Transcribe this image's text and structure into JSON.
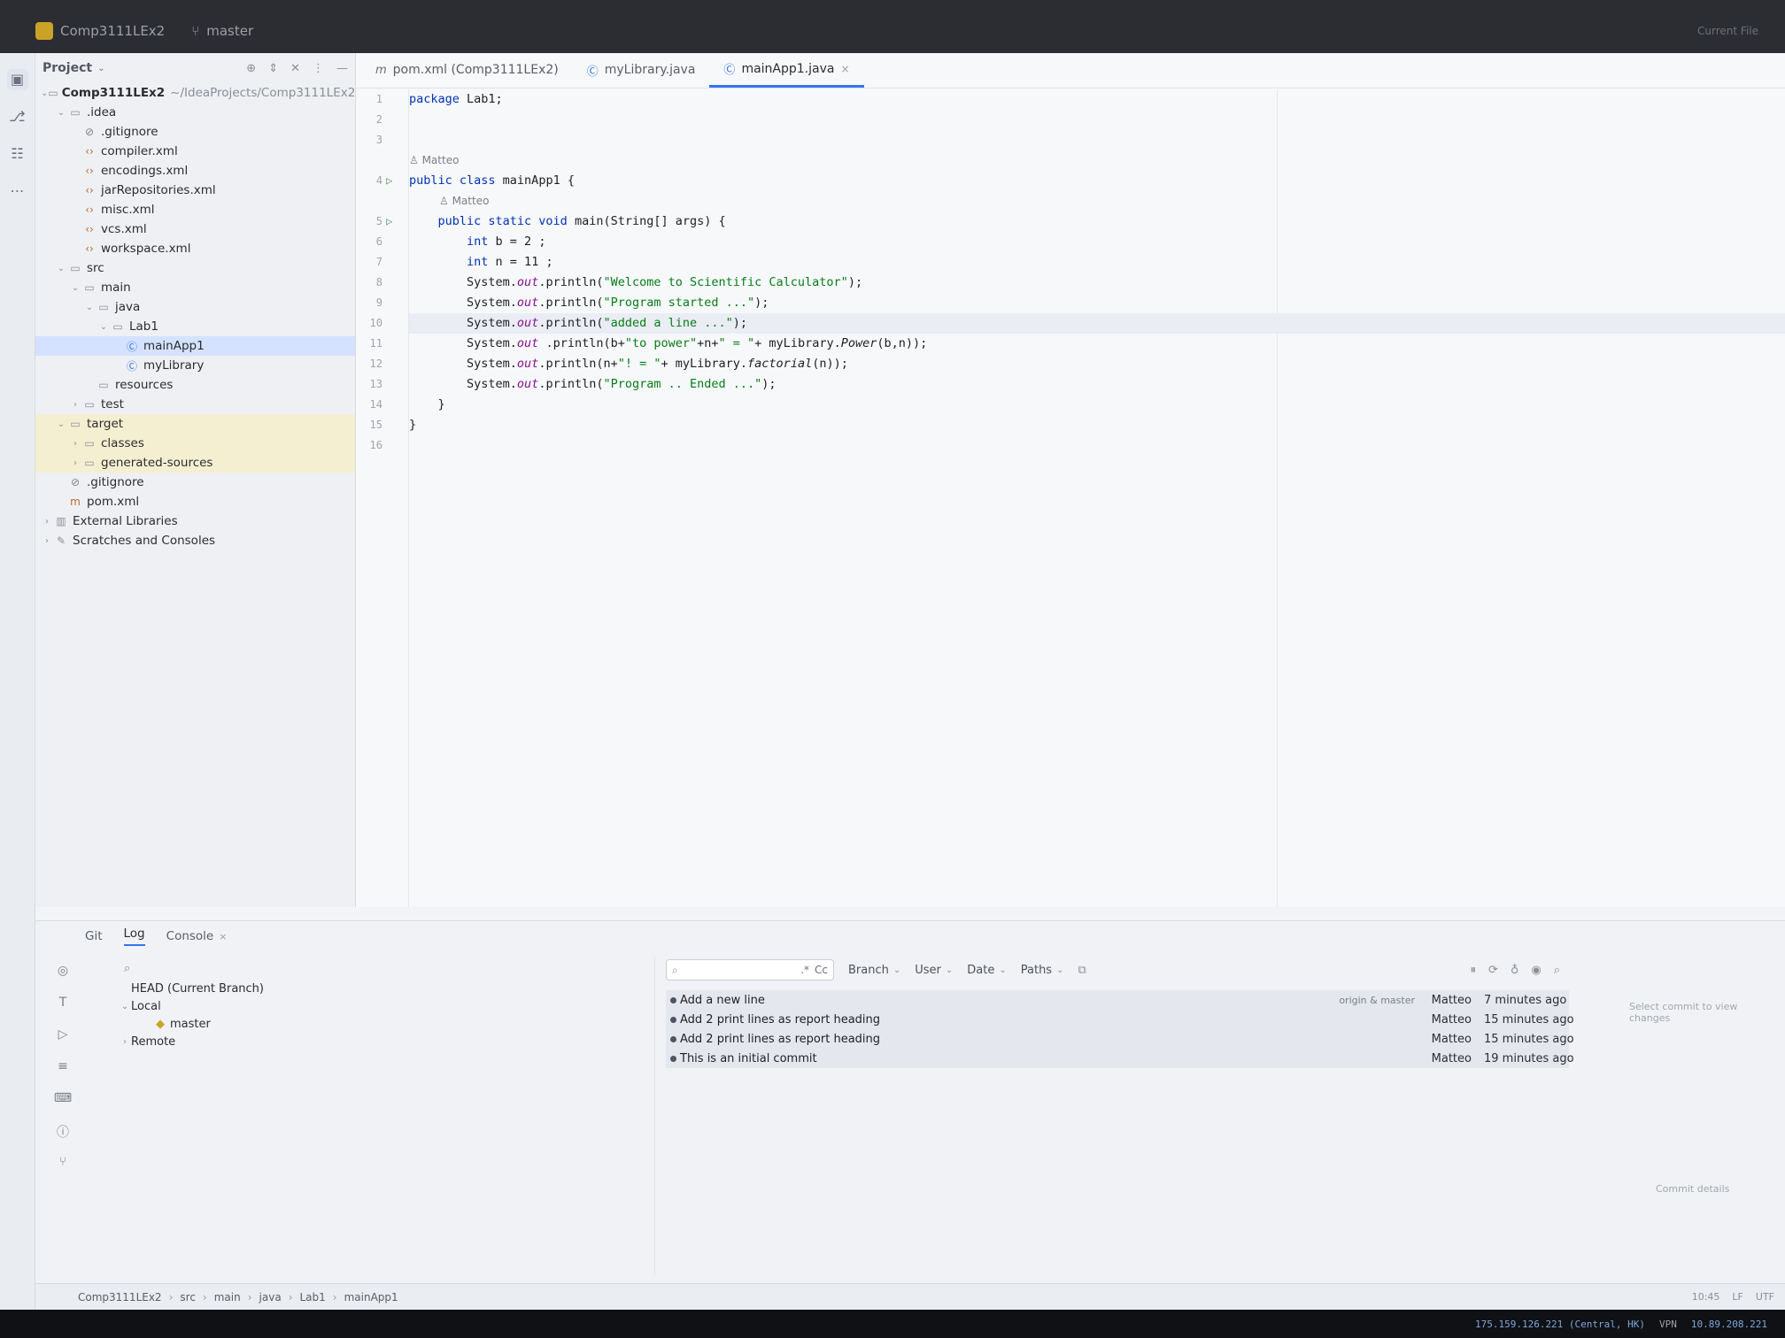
{
  "titlebar": {
    "project": "Comp3111LEx2",
    "branch": "master",
    "right_text": "Current File"
  },
  "project_panel": {
    "title": "Project",
    "tree": [
      {
        "label": "Comp3111LEx2",
        "extra": "~/IdeaProjects/Comp3111LEx2",
        "depth": 0,
        "icon": "folder",
        "open": true,
        "bold": true
      },
      {
        "label": ".idea",
        "depth": 1,
        "icon": "folder",
        "open": true
      },
      {
        "label": ".gitignore",
        "depth": 2,
        "icon": "ignore"
      },
      {
        "label": "compiler.xml",
        "depth": 2,
        "icon": "xml"
      },
      {
        "label": "encodings.xml",
        "depth": 2,
        "icon": "xml"
      },
      {
        "label": "jarRepositories.xml",
        "depth": 2,
        "icon": "xml"
      },
      {
        "label": "misc.xml",
        "depth": 2,
        "icon": "xml"
      },
      {
        "label": "vcs.xml",
        "depth": 2,
        "icon": "xml"
      },
      {
        "label": "workspace.xml",
        "depth": 2,
        "icon": "xml"
      },
      {
        "label": "src",
        "depth": 1,
        "icon": "folder",
        "open": true
      },
      {
        "label": "main",
        "depth": 2,
        "icon": "folder",
        "open": true
      },
      {
        "label": "java",
        "depth": 3,
        "icon": "folder",
        "open": true
      },
      {
        "label": "Lab1",
        "depth": 4,
        "icon": "folder",
        "open": true
      },
      {
        "label": "mainApp1",
        "depth": 5,
        "icon": "class",
        "selected": true
      },
      {
        "label": "myLibrary",
        "depth": 5,
        "icon": "class"
      },
      {
        "label": "resources",
        "depth": 3,
        "icon": "folder"
      },
      {
        "label": "test",
        "depth": 2,
        "icon": "folder",
        "closed": true
      },
      {
        "label": "target",
        "depth": 1,
        "icon": "folder",
        "open": true,
        "excluded": true
      },
      {
        "label": "classes",
        "depth": 2,
        "icon": "folder",
        "closed": true,
        "excluded": true
      },
      {
        "label": "generated-sources",
        "depth": 2,
        "icon": "folder",
        "closed": true,
        "excluded": true
      },
      {
        "label": ".gitignore",
        "depth": 1,
        "icon": "ignore"
      },
      {
        "label": "pom.xml",
        "depth": 1,
        "icon": "maven"
      },
      {
        "label": "External Libraries",
        "depth": 0,
        "icon": "library",
        "closed": true
      },
      {
        "label": "Scratches and Consoles",
        "depth": 0,
        "icon": "scratch",
        "closed": true
      }
    ]
  },
  "editor": {
    "tabs": [
      {
        "label": "pom.xml (Comp3111LEx2)",
        "icon": "m",
        "active": false
      },
      {
        "label": "myLibrary.java",
        "icon": "c",
        "active": false
      },
      {
        "label": "mainApp1.java",
        "icon": "c",
        "active": true
      }
    ],
    "author": "Matteo",
    "current_line": 10
  },
  "git": {
    "tabs": [
      "Git",
      "Log",
      "Console"
    ],
    "active_tab": "Log",
    "branches": {
      "head": "HEAD (Current Branch)",
      "local": "Local",
      "local_branch": "master",
      "remote": "Remote"
    },
    "filters": [
      "Branch",
      "User",
      "Date",
      "Paths"
    ],
    "search_regex": ".*",
    "search_case": "Cc",
    "commits": [
      {
        "message": "Add a new line",
        "refs": "origin & master",
        "author": "Matteo",
        "date": "7 minutes ago"
      },
      {
        "message": "Add 2 print lines as report heading",
        "refs": "",
        "author": "Matteo",
        "date": "15 minutes ago"
      },
      {
        "message": "Add 2 print lines as report heading",
        "refs": "",
        "author": "Matteo",
        "date": "15 minutes ago"
      },
      {
        "message": "This is an initial commit",
        "refs": "",
        "author": "Matteo",
        "date": "19 minutes ago"
      }
    ],
    "details_hint": "Select commit to view changes",
    "details_label": "Commit details"
  },
  "statusbar": {
    "breadcrumb": [
      "Comp3111LEx2",
      "src",
      "main",
      "java",
      "Lab1",
      "mainApp1"
    ],
    "position": "10:45",
    "line_sep": "LF",
    "encoding": "UTF"
  },
  "osbar": {
    "ip1": "175.159.126.221 (Central, HK)",
    "vpn": "VPN",
    "ip2": "10.89.208.221"
  }
}
